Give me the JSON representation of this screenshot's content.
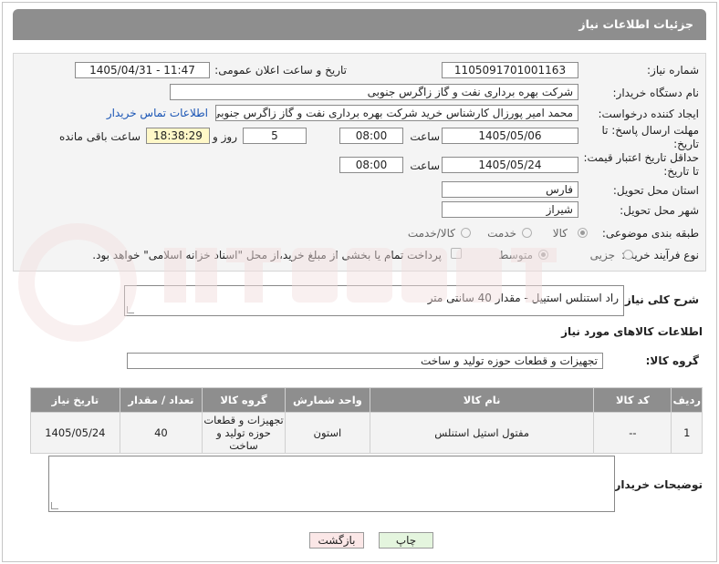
{
  "header": {
    "title": "جزئیات اطلاعات نیاز"
  },
  "form": {
    "need_number_label": "شماره نیاز:",
    "need_number": "1105091701001163",
    "announce_label": "تاریخ و ساعت اعلان عمومی:",
    "announce_value": "1405/04/31 - 11:47",
    "buyer_org_label": "نام دستگاه خریدار:",
    "buyer_org": "شرکت بهره برداری نفت و گاز زاگرس جنوبی",
    "creator_label": "ایجاد کننده درخواست:",
    "creator": "محمد امیر پورزال کارشناس خرید شرکت بهره برداری نفت و گاز زاگرس جنوبی",
    "contact_link": "اطلاعات تماس خریدار",
    "reply_deadline_label": "مهلت ارسال پاسخ: تا تاریخ:",
    "reply_date": "1405/05/06",
    "time_label": "ساعت",
    "reply_time": "08:00",
    "days": "5",
    "days_label": "روز و",
    "remaining_time": "18:38:29",
    "remaining_label": "ساعت باقی مانده",
    "price_deadline_label": "حداقل تاریخ اعتبار قیمت: تا تاریخ:",
    "price_date": "1405/05/24",
    "price_time": "08:00",
    "province_label": "استان محل تحویل:",
    "province": "فارس",
    "city_label": "شهر محل تحویل:",
    "city": "شیراز",
    "category_label": "طبقه بندی موضوعی:",
    "category_options": [
      "کالا",
      "خدمت",
      "کالا/خدمت"
    ],
    "process_label": "نوع فرآیند خرید :",
    "process_options": [
      "جزیی",
      "متوسط"
    ],
    "payment_text": "پرداخت تمام یا بخشی از مبلغ خرید،از محل \"اسناد خزانه اسلامی\" خواهد بود."
  },
  "summary": {
    "label": "شرح کلی نیاز:",
    "value": "راد استنلس استییل - مقدار 40 سانتی متر"
  },
  "goods": {
    "section_title": "اطلاعات کالاهای مورد نیاز",
    "group_label": "گروه کالا:",
    "group_value": "تجهیزات و قطعات حوزه تولید و ساخت"
  },
  "table": {
    "headers": [
      "ردیف",
      "کد کالا",
      "نام کالا",
      "واحد شمارش",
      "گروه کالا",
      "تعداد / مقدار",
      "تاریخ نیاز"
    ],
    "rows": [
      [
        "1",
        "--",
        "مفتول استیل استنلس",
        "استون",
        "تجهیزات و قطعات حوزه تولید و ساخت",
        "40",
        "1405/05/24"
      ]
    ]
  },
  "buyer_notes_label": "توضیحات خریدار:",
  "buttons": {
    "print": "چاپ",
    "back": "بازگشت"
  },
  "colors": {
    "header": "#8e8e8e",
    "print_button": "#e4f5de",
    "back_button": "#fbe7e7",
    "link": "#1a55b5"
  },
  "watermark": "AriaTender.net"
}
